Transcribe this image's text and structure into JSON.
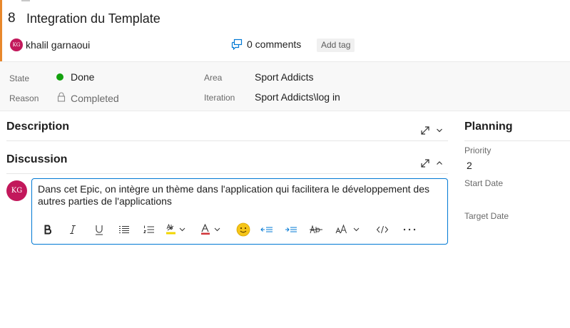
{
  "work_item": {
    "id": "8",
    "title": "Integration du Template",
    "author": {
      "name": "khalil garnaoui",
      "initials": "KG",
      "avatar_color": "#c2185b"
    },
    "comments_label": "0 comments",
    "add_tag_label": "Add tag",
    "accent_color": "#e8882c"
  },
  "fields": {
    "state": {
      "label": "State",
      "value": "Done",
      "dot_color": "#13a10e"
    },
    "reason": {
      "label": "Reason",
      "value": "Completed"
    },
    "area": {
      "label": "Area",
      "value": "Sport Addicts"
    },
    "iteration": {
      "label": "Iteration",
      "value": "Sport Addicts\\log in"
    }
  },
  "sections": {
    "description": {
      "title": "Description"
    },
    "discussion": {
      "title": "Discussion"
    }
  },
  "discussion": {
    "avatar_initials": "KG",
    "draft_text": "Dans cet Epic, on intègre un thème dans l'application qui facilitera le développement des autres parties de l'applications",
    "toolbar": [
      "bold-icon",
      "italic-icon",
      "underline-icon",
      "bulleted-list-icon",
      "numbered-list-icon",
      "highlight-icon",
      "font-color-icon",
      "emoji-icon",
      "decrease-indent-icon",
      "increase-indent-icon",
      "strikethrough-icon",
      "font-size-icon",
      "code-icon",
      "more-icon"
    ]
  },
  "planning": {
    "title": "Planning",
    "priority": {
      "label": "Priority",
      "value": "2"
    },
    "start_date": {
      "label": "Start Date",
      "value": ""
    },
    "target_date": {
      "label": "Target Date",
      "value": ""
    }
  }
}
